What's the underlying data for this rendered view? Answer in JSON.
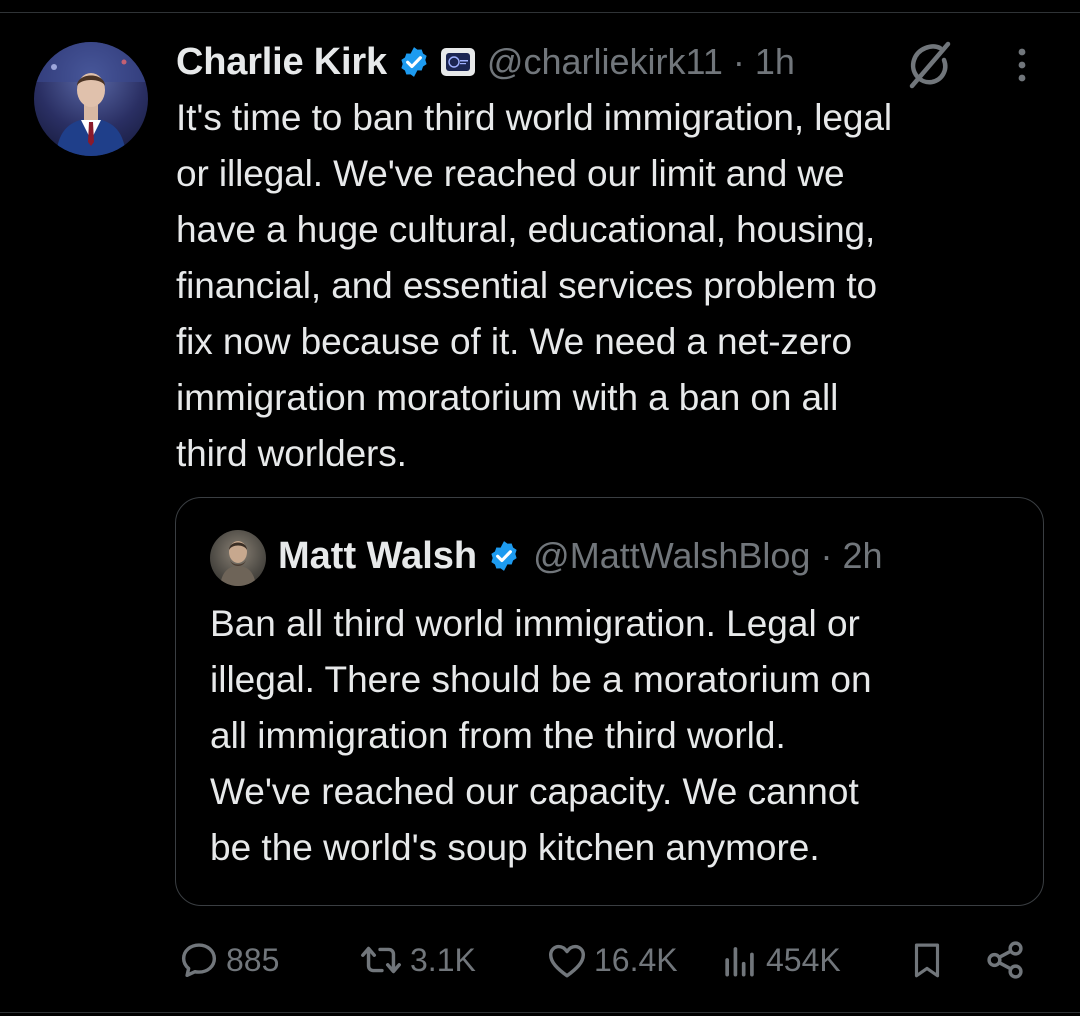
{
  "tweet": {
    "author_name": "Charlie Kirk",
    "handle_time": "@charliekirk11 · 1h",
    "text": "It's time to ban third world immigration, legal\nor illegal. We've reached our limit and we\nhave a huge cultural, educational, housing,\nfinancial, and essential services problem to\nfix now because of it. We need a net-zero\nimmigration moratorium with a ban on all\nthird worlders."
  },
  "quoted": {
    "author_name": "Matt Walsh",
    "handle_time": "@MattWalshBlog · 2h",
    "text": "Ban all third world immigration. Legal or\nillegal. There should be a moratorium on\nall immigration from the third world.\nWe've reached our capacity. We cannot\nbe the world's soup kitchen anymore."
  },
  "actions": {
    "replies": "885",
    "reposts": "3.1K",
    "likes": "16.4K",
    "views": "454K"
  },
  "colors": {
    "background": "#000000",
    "text": "#e7e9ea",
    "muted": "#71767b",
    "verified": "#1d9bf0"
  },
  "icons": [
    "verified-badge-icon",
    "affiliate-badge-icon",
    "grok-icon",
    "more-icon",
    "reply-icon",
    "repost-icon",
    "like-icon",
    "views-icon",
    "bookmark-icon",
    "share-icon"
  ]
}
